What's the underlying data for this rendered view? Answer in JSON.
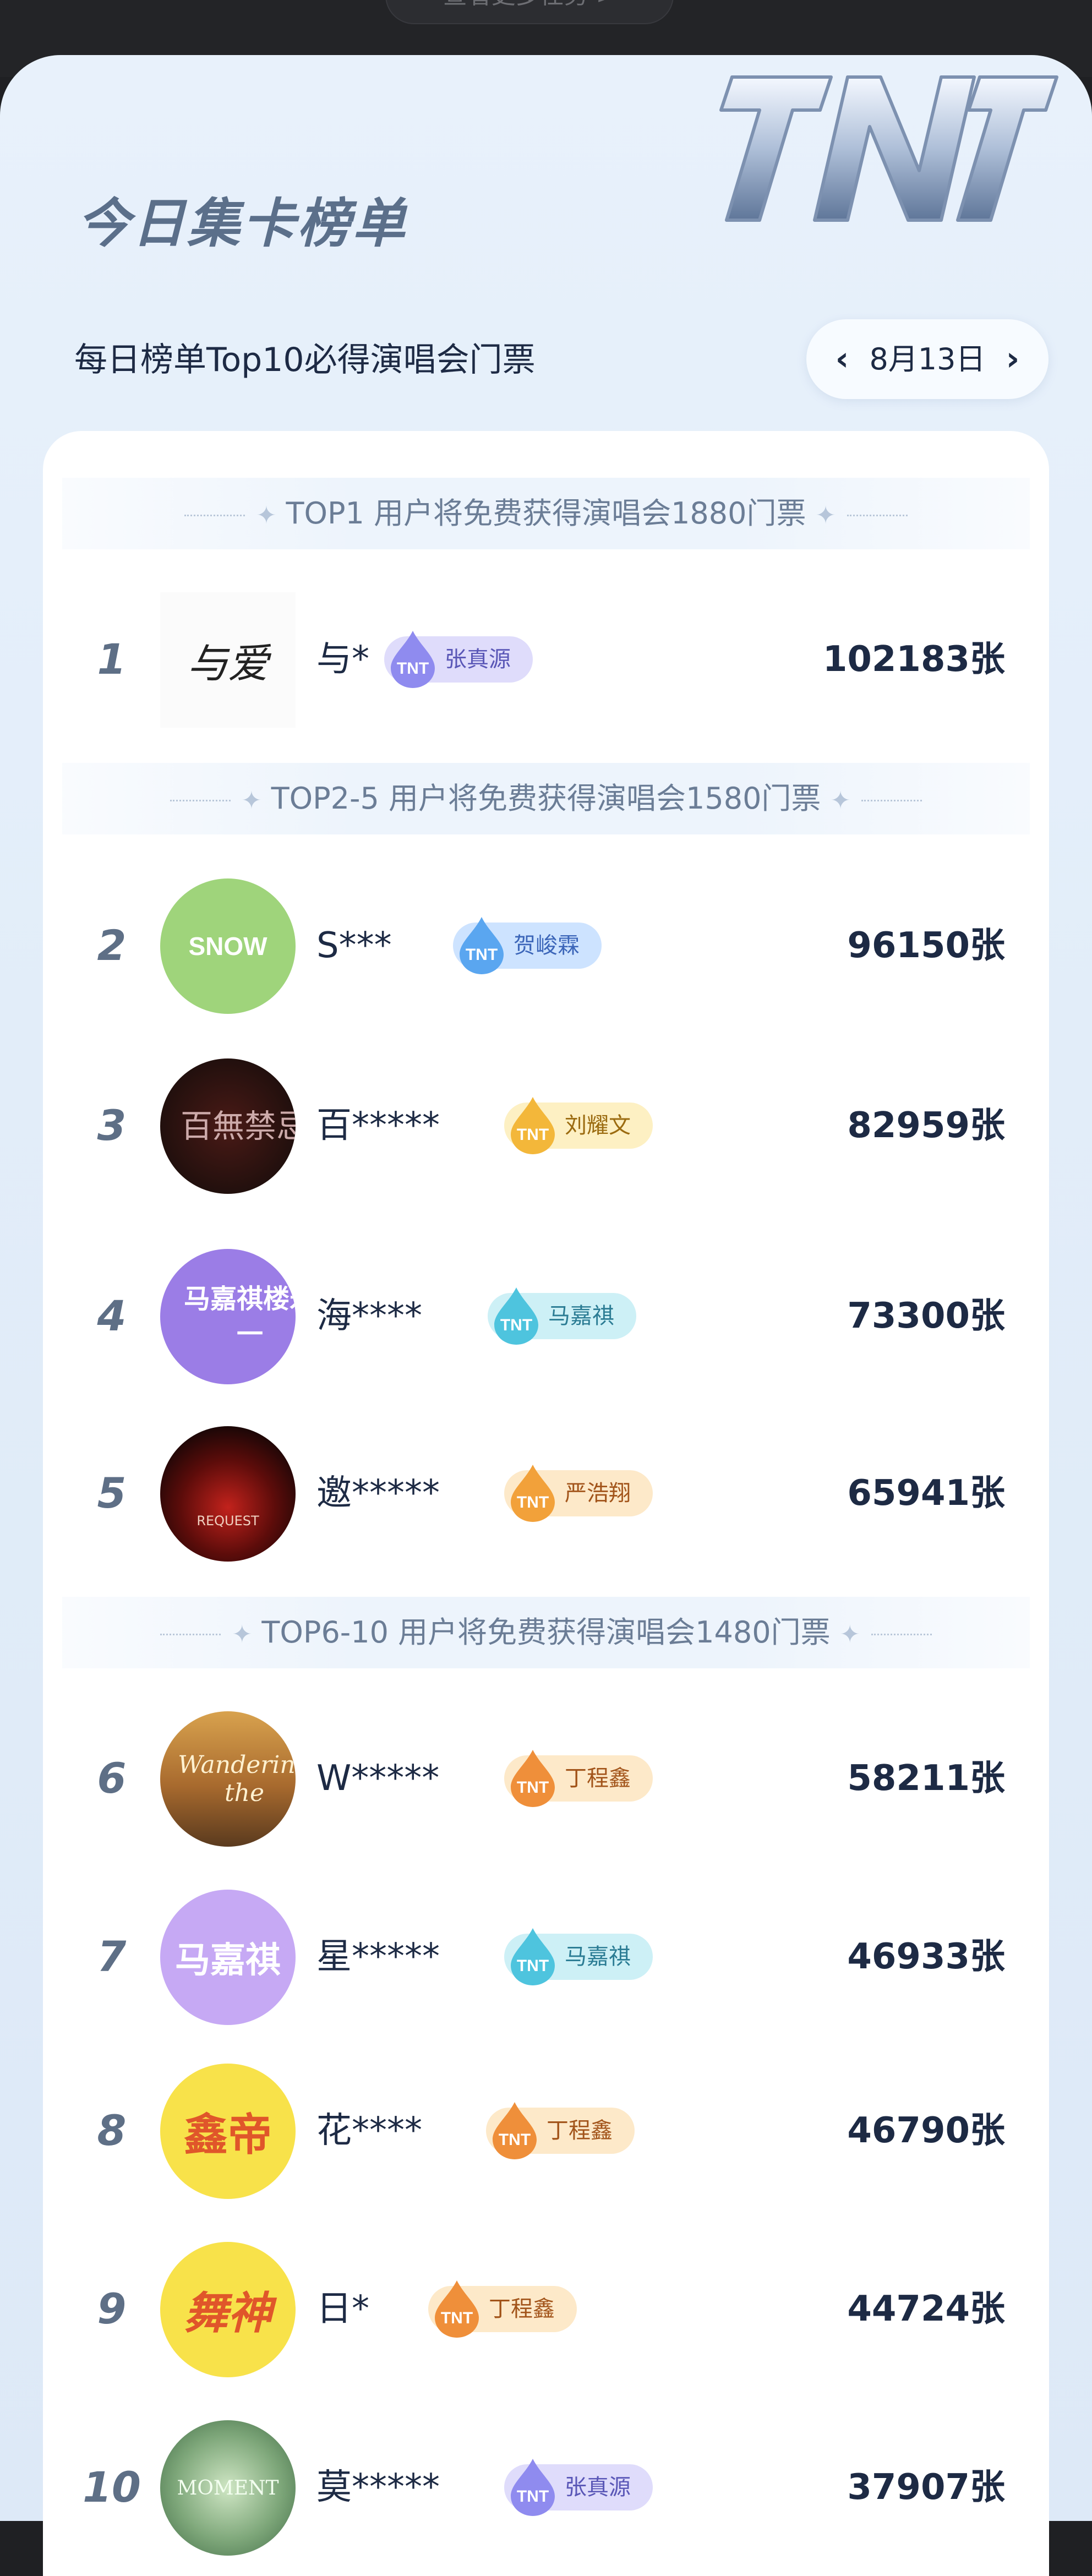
{
  "header": {
    "top_link": "查看更多任务 >",
    "title": "今日集卡榜单",
    "logo_text": "TNT",
    "subtitle": "每日榜单Top10必得演唱会门票",
    "date": "8月13日",
    "prev_icon": "chevron-left",
    "next_icon": "chevron-right"
  },
  "tiers": [
    {
      "label": "TOP1 用户将免费获得演唱会1880门票"
    },
    {
      "label": "TOP2-5 用户将免费获得演唱会1580门票"
    },
    {
      "label": "TOP6-10 用户将免费获得演唱会1480门票"
    }
  ],
  "colors": {
    "accent": "#1d2a44",
    "badge_blue": "#cde3ff",
    "badge_purple": "#dfdcfb",
    "badge_orange": "#fde9c9",
    "badge_cyan": "#cdf0f6",
    "badge_gold": "#fdf0c3"
  },
  "rows": [
    {
      "rank": "1",
      "name": "与*",
      "badge": "张真源",
      "count": "102183张",
      "avatar_text": "与爱"
    },
    {
      "rank": "2",
      "name": "S***",
      "badge": "贺峻霖",
      "count": "96150张",
      "avatar_text": "SNOW"
    },
    {
      "rank": "3",
      "name": "百*****",
      "badge": "刘耀文",
      "count": "82959张",
      "avatar_text": "百無禁忌"
    },
    {
      "rank": "4",
      "name": "海****",
      "badge": "马嘉祺",
      "count": "73300张",
      "avatar_text": "马嘉祺楼永一"
    },
    {
      "rank": "5",
      "name": "邀*****",
      "badge": "严浩翔",
      "count": "65941张",
      "avatar_text": "REQUEST"
    },
    {
      "rank": "6",
      "name": "W*****",
      "badge": "丁程鑫",
      "count": "58211张",
      "avatar_text": "Wandering the"
    },
    {
      "rank": "7",
      "name": "星*****",
      "badge": "马嘉祺",
      "count": "46933张",
      "avatar_text": "马嘉祺"
    },
    {
      "rank": "8",
      "name": "花****",
      "badge": "丁程鑫",
      "count": "46790张",
      "avatar_text": "鑫帝"
    },
    {
      "rank": "9",
      "name": "日*",
      "badge": "丁程鑫",
      "count": "44724张",
      "avatar_text": "舞神"
    },
    {
      "rank": "10",
      "name": "莫*****",
      "badge": "张真源",
      "count": "37907张",
      "avatar_text": "MOMENT"
    }
  ]
}
